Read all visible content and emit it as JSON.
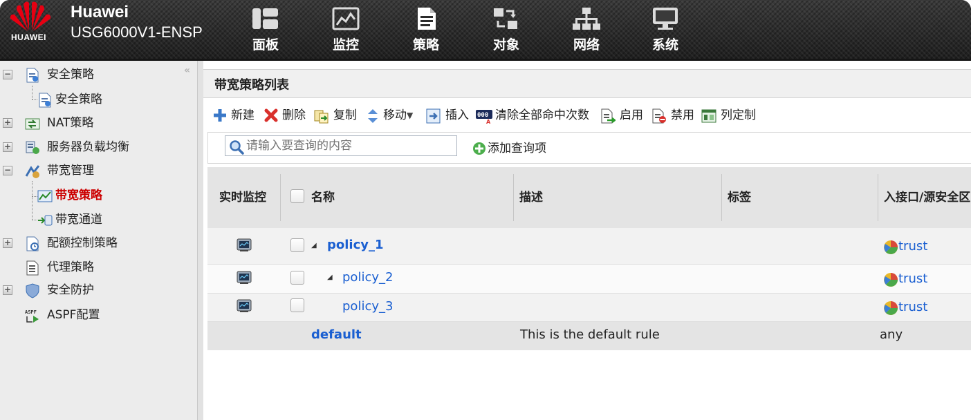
{
  "header": {
    "logo_text": "HUAWEI",
    "brand_name": "Huawei",
    "device_model": "USG6000V1-ENSP",
    "nav": [
      {
        "label": "面板",
        "icon": "dashboard-icon"
      },
      {
        "label": "监控",
        "icon": "monitor-chart-icon"
      },
      {
        "label": "策略",
        "icon": "policy-document-icon"
      },
      {
        "label": "对象",
        "icon": "objects-icon"
      },
      {
        "label": "网络",
        "icon": "network-icon"
      },
      {
        "label": "系统",
        "icon": "system-computer-icon"
      }
    ],
    "active_nav": "策略"
  },
  "sidebar": {
    "collapse": "«",
    "items": [
      {
        "label": "安全策略",
        "toggle": "−",
        "level": 0
      },
      {
        "label": "安全策略",
        "level": 1
      },
      {
        "label": "NAT策略",
        "toggle": "+",
        "level": 0
      },
      {
        "label": "服务器负载均衡",
        "toggle": "+",
        "level": 0
      },
      {
        "label": "带宽管理",
        "toggle": "−",
        "level": 0
      },
      {
        "label": "带宽策略",
        "level": 1,
        "active": true
      },
      {
        "label": "带宽通道",
        "level": 1
      },
      {
        "label": "配额控制策略",
        "toggle": "+",
        "level": 0
      },
      {
        "label": "代理策略",
        "level": 0
      },
      {
        "label": "安全防护",
        "toggle": "+",
        "level": 0
      },
      {
        "label": "ASPF配置",
        "level": 0
      }
    ]
  },
  "panel": {
    "title": "带宽策略列表"
  },
  "toolbar": {
    "new": "新建",
    "delete": "删除",
    "copy": "复制",
    "move": "移动",
    "insert": "插入",
    "clear_hits": "清除全部命中次数",
    "enable": "启用",
    "disable": "禁用",
    "columns": "列定制"
  },
  "filter": {
    "search_placeholder": "请输入要查询的内容",
    "add_query": "添加查询项"
  },
  "table": {
    "columns": [
      "实时监控",
      "名称",
      "描述",
      "标签",
      "入接口/源安全区"
    ],
    "rows": [
      {
        "name": "policy_1",
        "description": "",
        "tag": "",
        "zone": "trust"
      },
      {
        "name": "policy_2",
        "description": "",
        "tag": "",
        "zone": "trust"
      },
      {
        "name": "policy_3",
        "description": "",
        "tag": "",
        "zone": "trust"
      },
      {
        "name": "default",
        "description": "This is the default rule",
        "tag": "",
        "zone": "any"
      }
    ]
  },
  "colors": {
    "link": "#1a5fd1",
    "active_tree": "#cc0000",
    "header_bg": "#2b2b2b",
    "huawei_red": "#e60012"
  }
}
